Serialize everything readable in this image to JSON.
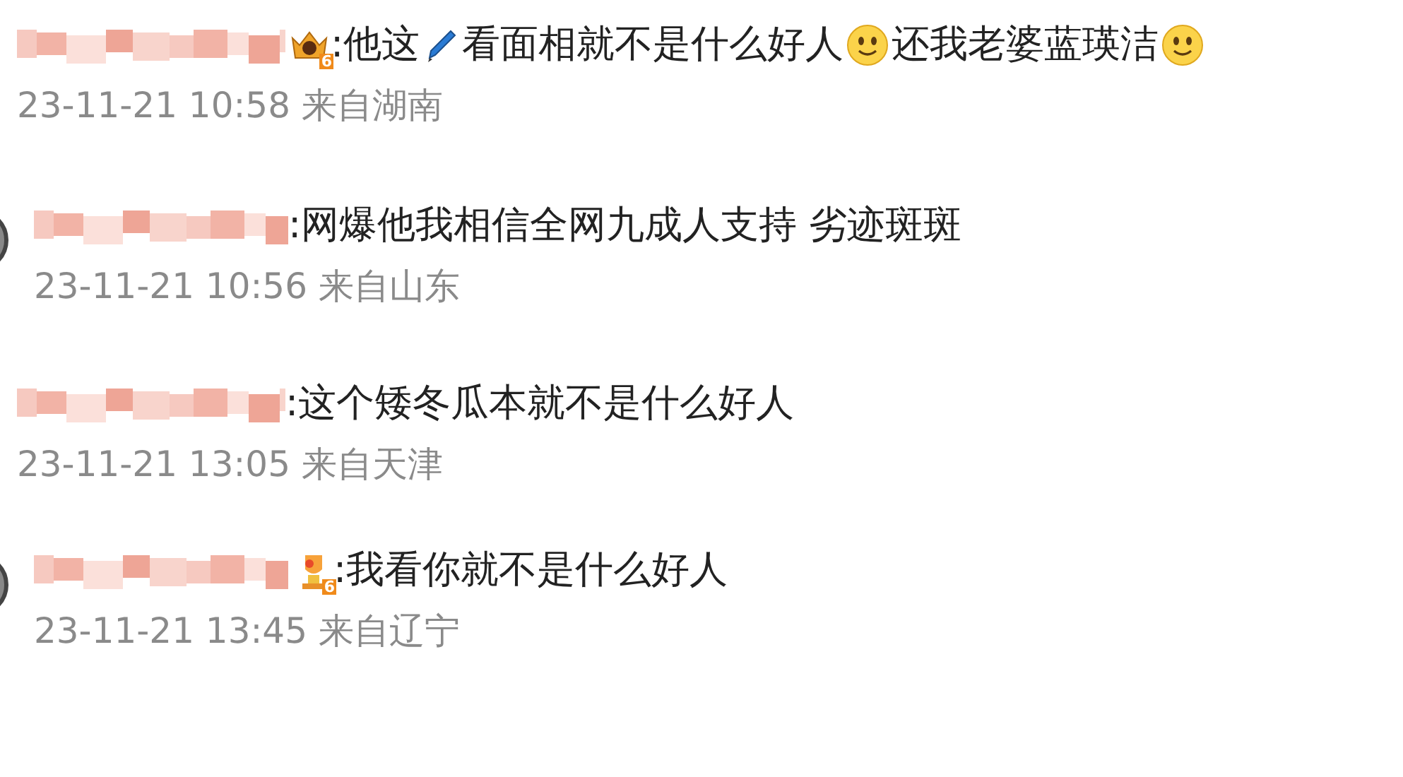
{
  "comments": [
    {
      "avatar": false,
      "badge": {
        "kind": "crown",
        "level": "6"
      },
      "segments": [
        {
          "kind": "text",
          "text": ":他这"
        },
        {
          "kind": "pen"
        },
        {
          "kind": "text",
          "text": "看面相就不是什么好人"
        },
        {
          "kind": "smile"
        },
        {
          "kind": "text",
          "text": "还我老婆蓝瑛洁"
        },
        {
          "kind": "smile"
        }
      ],
      "meta": "23-11-21 10:58 来自湖南"
    },
    {
      "avatar": true,
      "segments": [
        {
          "kind": "text",
          "text": ":网爆他我相信全网九成人支持 劣迹斑斑"
        }
      ],
      "meta": "23-11-21 10:56 来自山东"
    },
    {
      "avatar": false,
      "segments": [
        {
          "kind": "text",
          "text": ":这个矮冬瓜本就不是什么好人"
        }
      ],
      "meta": "23-11-21 13:05 来自天津"
    },
    {
      "avatar": true,
      "badge": {
        "kind": "trophy",
        "level": "6"
      },
      "segments": [
        {
          "kind": "text",
          "text": ":我看你就不是什么好人"
        }
      ],
      "meta": "23-11-21 13:45 来自辽宁"
    }
  ]
}
